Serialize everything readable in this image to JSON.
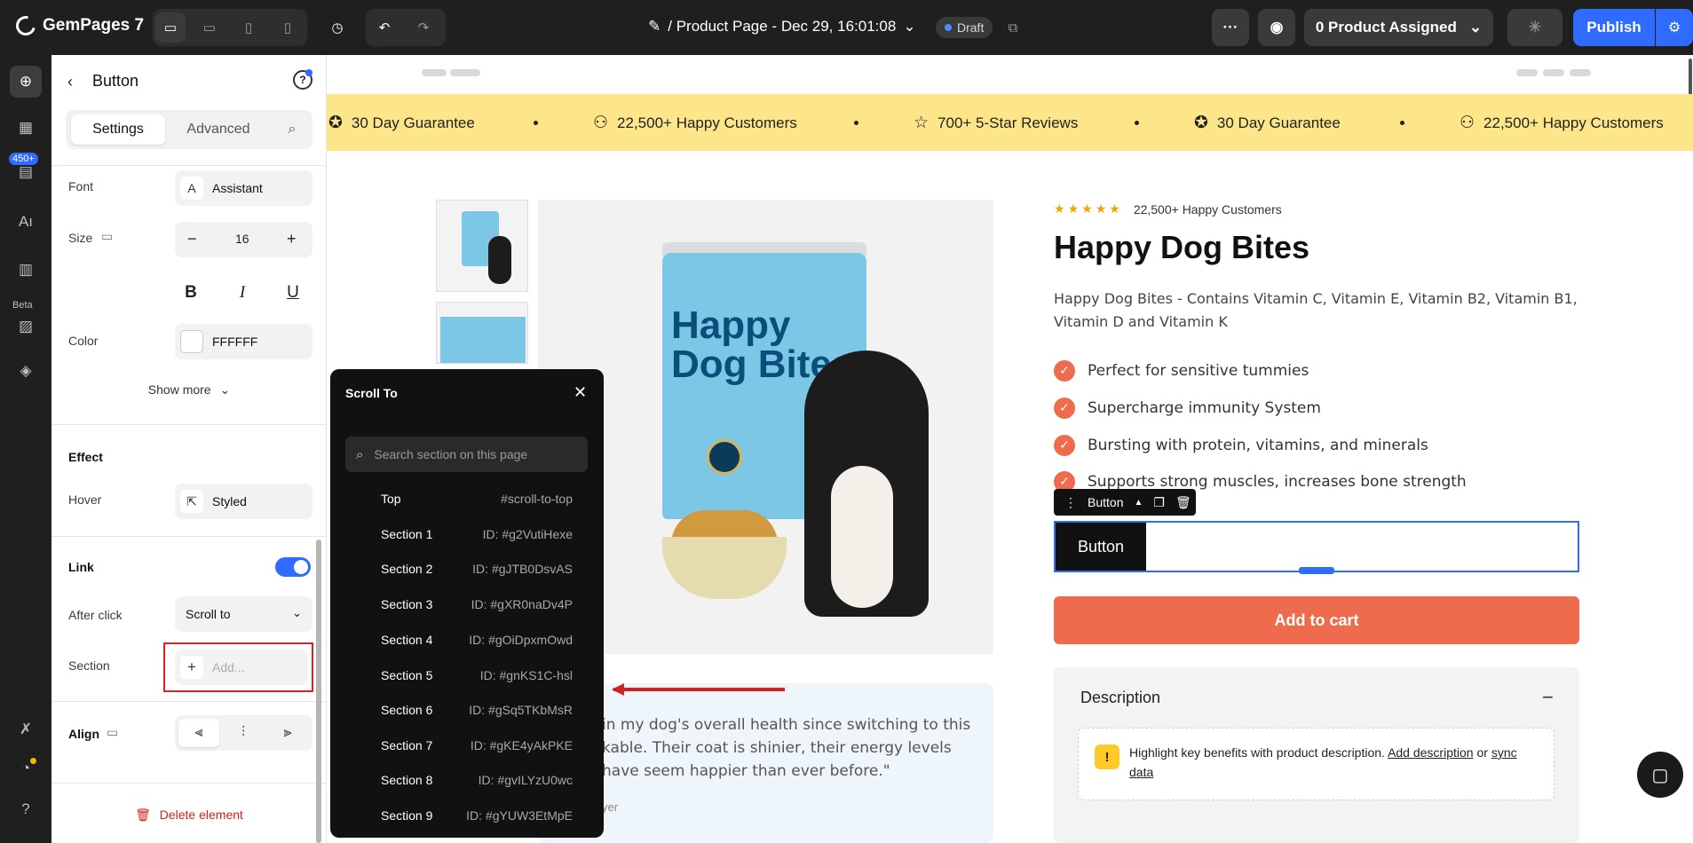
{
  "app": {
    "name": "GemPages 7",
    "page_title": "/ Product Page - Dec 29, 16:01:08",
    "draft_label": "Draft",
    "product_assigned": "0 Product Assigned",
    "publish_label": "Publish"
  },
  "rail": {
    "badge": "450+",
    "beta": "Beta"
  },
  "panel": {
    "title": "Button",
    "tabs": [
      "Settings",
      "Advanced"
    ],
    "font_label": "Font",
    "font_value": "Assistant",
    "size_label": "Size",
    "size_value": "16",
    "color_label": "Color",
    "color_value": "FFFFFF",
    "show_more": "Show more",
    "effect_title": "Effect",
    "hover_label": "Hover",
    "hover_value": "Styled",
    "link_title": "Link",
    "link_enabled": true,
    "after_click_label": "After click",
    "after_click_value": "Scroll to",
    "section_label": "Section",
    "section_placeholder": "Add...",
    "align_title": "Align",
    "delete_label": "Delete element"
  },
  "scroll_popup": {
    "title": "Scroll To",
    "search_placeholder": "Search section on this page",
    "rows": [
      {
        "name": "Top",
        "id": "#scroll-to-top"
      },
      {
        "name": "Section 1",
        "id": "ID: #g2VutiHexe"
      },
      {
        "name": "Section 2",
        "id": "ID: #gJTB0DsvAS"
      },
      {
        "name": "Section 3",
        "id": "ID: #gXR0naDv4P"
      },
      {
        "name": "Section 4",
        "id": "ID: #gOiDpxmOwd"
      },
      {
        "name": "Section 5",
        "id": "ID: #gnKS1C-hsl"
      },
      {
        "name": "Section 6",
        "id": "ID: #gSq5TKbMsR"
      },
      {
        "name": "Section 7",
        "id": "ID: #gKE4yAkPKE"
      },
      {
        "name": "Section 8",
        "id": "ID: #gvILYzU0wc"
      },
      {
        "name": "Section 9",
        "id": "ID: #gYUW3EtMpE"
      }
    ]
  },
  "marquee": {
    "items": [
      {
        "icon": "badge-check-icon",
        "text": "30 Day Guarantee"
      },
      {
        "icon": "users-icon",
        "text": "22,500+ Happy Customers"
      },
      {
        "icon": "star-outline-icon",
        "text": "700+ 5-Star Reviews"
      },
      {
        "icon": "badge-check-icon",
        "text": "30 Day Guarantee"
      },
      {
        "icon": "users-icon",
        "text": "22,500+ Happy Customers"
      }
    ]
  },
  "product": {
    "rating_text": "22,500+ Happy Customers",
    "stars": 5,
    "title": "Happy Dog Bites",
    "description": "Happy Dog Bites - Contains Vitamin C, Vitamin E, Vitamin B2, Vitamin B1, Vitamin D and Vitamin K",
    "benefits": [
      "Perfect for sensitive tummies",
      "Supercharge immunity System",
      "Bursting with protein, vitamins, and minerals",
      "Supports strong muscles, increases bone strength"
    ],
    "button_toolbar_label": "Button",
    "button_label": "Button",
    "add_to_cart": "Add to cart",
    "description_title": "Description",
    "note_text": "Highlight key benefits with product description.",
    "note_link": "Add description",
    "note_or": "or",
    "note_link2": "sync data",
    "bag_text": "Happy Dog Bites",
    "review_text": "in my dog's overall health since switching to this kable. Their coat is shinier, their energy levels have seem happier than ever before.\"",
    "review_author": "yer"
  },
  "colors": {
    "accent": "#2f6bff",
    "cta": "#ee6c4d",
    "marquee_bg": "#fde68a",
    "highlight": "#d42020"
  }
}
